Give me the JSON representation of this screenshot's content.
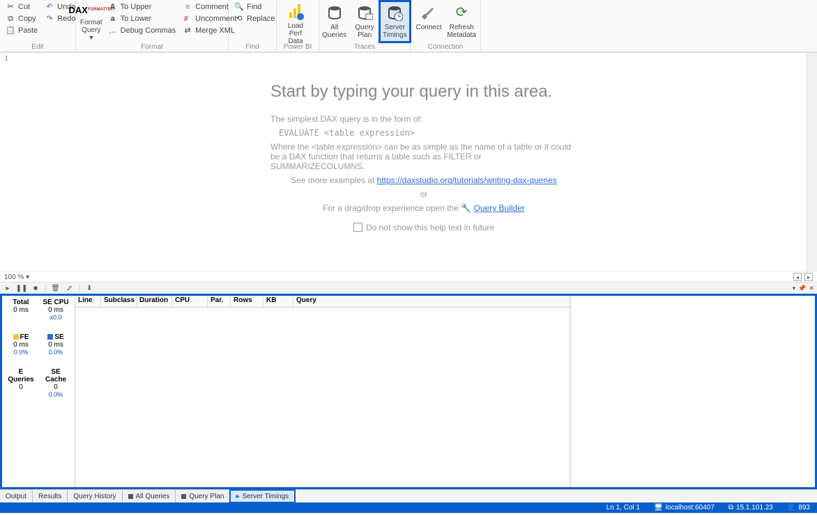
{
  "ribbon": {
    "edit": {
      "cut": "Cut",
      "copy": "Copy",
      "paste": "Paste",
      "undo": "Undo",
      "redo": "Redo",
      "label": "Edit"
    },
    "format": {
      "dax": "Format Query",
      "upper": "To Upper",
      "lower": "To Lower",
      "debug": "Debug Commas",
      "comment": "Comment",
      "uncomment": "Uncomment",
      "merge": "Merge XML",
      "label": "Format"
    },
    "find": {
      "find": "Find",
      "replace": "Replace",
      "label": "Find"
    },
    "powerbi": {
      "load": "Load Perf Data",
      "label": "Power BI"
    },
    "traces": {
      "all": "All Queries",
      "plan": "Query Plan",
      "timings": "Server Timings",
      "label": "Traces"
    },
    "connection": {
      "connect": "Connect",
      "refresh": "Refresh Metadata",
      "label": "Connection"
    }
  },
  "editor": {
    "line_num": "1",
    "heading": "Start by typing your query in this area.",
    "p1": "The simplest DAX query is in the form of:",
    "code": "EVALUATE <table expression>",
    "p2": "Where the <table expression> can be as simple as the name of a table or it could be a DAX function that returns a table such as FILTER or SUMMARIZECOLUMNS.",
    "p3a": "See more examples at ",
    "p3link": "https://daxstudio.org/tutorials/writing-dax-queries",
    "or": "or",
    "p4a": "For a drag/drop experience open the ",
    "p4link": "Query Builder",
    "dont_show": "Do not show this help text in future",
    "zoom": "100 %"
  },
  "timings": {
    "stats": {
      "total": {
        "h": "Total",
        "v": "0 ms"
      },
      "secpu": {
        "h": "SE CPU",
        "v": "0 ms",
        "s": "x0.0"
      },
      "fe": {
        "h": "FE",
        "v": "0 ms",
        "s": "0.0%"
      },
      "se": {
        "h": "SE",
        "v": "0 ms",
        "s": "0.0%"
      },
      "equeries": {
        "h": "E Queries",
        "v": "0"
      },
      "secache": {
        "h": "SE Cache",
        "v": "0",
        "s": "0.0%"
      }
    },
    "cols": {
      "line": "Line",
      "subclass": "Subclass",
      "duration": "Duration",
      "cpu": "CPU",
      "par": "Par.",
      "rows": "Rows",
      "kb": "KB",
      "query": "Query"
    }
  },
  "tabs": {
    "output": "Output",
    "results": "Results",
    "history": "Query History",
    "all": "All Queries",
    "plan": "Query Plan",
    "timings": "Server Timings"
  },
  "status": {
    "pos": "Ln 1, Col 1",
    "server": "localhost:60407",
    "ver": "15.1.101.23",
    "rows": "893"
  }
}
